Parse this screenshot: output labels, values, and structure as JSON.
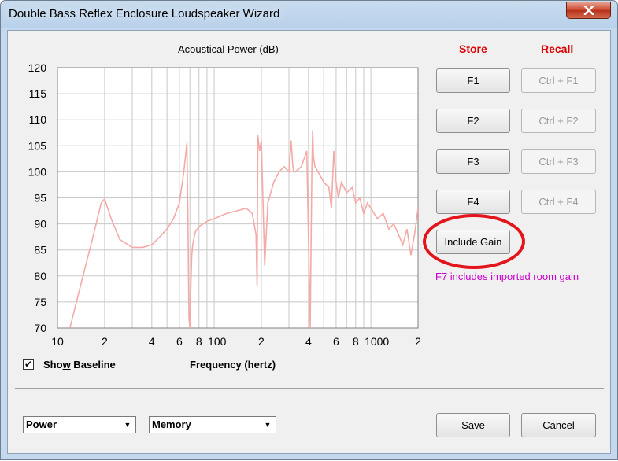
{
  "window": {
    "title": "Double Bass Reflex Enclosure Loudspeaker Wizard",
    "close_icon": "close-x-icon"
  },
  "chart": {
    "title": "Acoustical Power (dB)",
    "xlabel": "Frequency (hertz)"
  },
  "chart_data": {
    "type": "line",
    "title": "Acoustical Power (dB)",
    "xlabel": "Frequency (hertz)",
    "ylabel": "",
    "x_scale": "log",
    "xlim": [
      10,
      2000
    ],
    "ylim": [
      70,
      120
    ],
    "grid": true,
    "y_ticks": [
      "120",
      "115",
      "110",
      "105",
      "100",
      "95",
      "90",
      "85",
      "80",
      "75",
      "70"
    ],
    "x_ticks": [
      "10",
      "2",
      "4",
      "6",
      "8",
      "100",
      "2",
      "4",
      "6",
      "8",
      "1000",
      "2"
    ],
    "series": [
      {
        "color": "#f4aaa6",
        "x": [
          12,
          14,
          17,
          19,
          20,
          22,
          25,
          30,
          35,
          40,
          45,
          50,
          55,
          60,
          64,
          67,
          68,
          69,
          70,
          71,
          72,
          73,
          74,
          76,
          80,
          90,
          100,
          120,
          140,
          160,
          175,
          185,
          188,
          190,
          195,
          200,
          210,
          220,
          240,
          260,
          280,
          300,
          310,
          318,
          322,
          330,
          360,
          390,
          410,
          420,
          425,
          430,
          440,
          460,
          500,
          540,
          560,
          580,
          600,
          620,
          650,
          700,
          760,
          800,
          850,
          900,
          950,
          1000,
          1100,
          1200,
          1300,
          1400,
          1500,
          1600,
          1700,
          1800,
          1900,
          2000
        ],
        "y": [
          70,
          78,
          88,
          94,
          94.8,
          91,
          87,
          85.5,
          85.5,
          86,
          87.5,
          89,
          91,
          94,
          100,
          105.5,
          91,
          72,
          70,
          78,
          84,
          86,
          87,
          88.5,
          89.5,
          90.5,
          91,
          92,
          92.5,
          93,
          92,
          88,
          78,
          107,
          104,
          106,
          82,
          94,
          98,
          100,
          101,
          100,
          106,
          101,
          100,
          100,
          101,
          104,
          70,
          100,
          108,
          103,
          101,
          100,
          98,
          97,
          93,
          104,
          98,
          95,
          98,
          96,
          97,
          94,
          95,
          92,
          94,
          93,
          91,
          92,
          89,
          90,
          88,
          86,
          89,
          84,
          88,
          93
        ]
      }
    ]
  },
  "buttons": {
    "store_header": "Store",
    "recall_header": "Recall",
    "store": [
      "F1",
      "F2",
      "F3",
      "F4"
    ],
    "recall": [
      "Ctrl + F1",
      "Ctrl + F2",
      "Ctrl + F3",
      "Ctrl + F4"
    ],
    "include_gain": "Include Gain",
    "save": "Save",
    "cancel": "Cancel"
  },
  "hint": "F7 includes imported room gain",
  "show_baseline": {
    "label": "Show Baseline",
    "checked": true,
    "check_glyph": "✔"
  },
  "selects": {
    "left_value": "Power",
    "right_value": "Memory",
    "arrow_glyph": "▼"
  },
  "colors": {
    "curve": "#f4aaa6",
    "header_red": "#dd0000",
    "hint_magenta": "#cc00cc",
    "annotation_oval": "#e3141b"
  }
}
